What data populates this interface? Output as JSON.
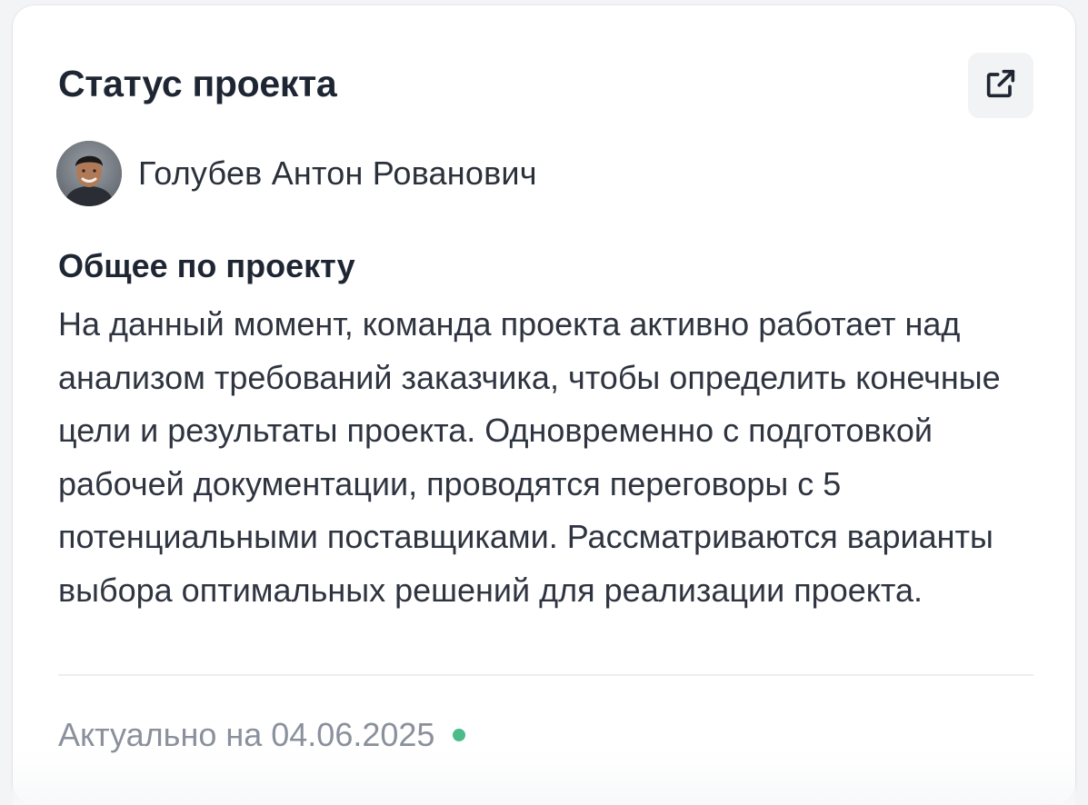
{
  "card": {
    "title": "Статус проекта",
    "open_icon": "external-link-icon",
    "author": {
      "name": "Голубев Антон Рованович",
      "avatar_icon": "avatar"
    },
    "section_heading": "Общее по проекту",
    "body": "На данный момент, команда проекта активно работает над анализом требований заказчика, чтобы определить конечные цели и результаты проекта. Одновременно с подготовкой рабочей документации, проводятся переговоры с 5 потенциальными поставщиками. Рассматриваются варианты выбора оптимальных решений для реализации проекта.",
    "footer": {
      "updated_text": "Актуально на 04.06.2025",
      "status_color": "#4cbb8a"
    }
  },
  "colors": {
    "title": "#1f2633",
    "text": "#2f3540",
    "muted": "#8a919c",
    "status_ok": "#4cbb8a"
  }
}
